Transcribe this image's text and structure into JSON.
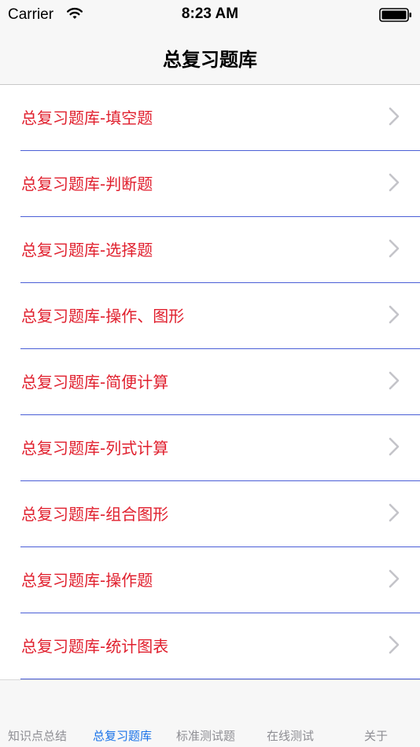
{
  "status_bar": {
    "carrier": "Carrier",
    "time": "8:23 AM"
  },
  "nav": {
    "title": "总复习题库"
  },
  "list": {
    "items": [
      {
        "label": "总复习题库-填空题"
      },
      {
        "label": "总复习题库-判断题"
      },
      {
        "label": "总复习题库-选择题"
      },
      {
        "label": "总复习题库-操作、图形"
      },
      {
        "label": "总复习题库-简便计算"
      },
      {
        "label": "总复习题库-列式计算"
      },
      {
        "label": "总复习题库-组合图形"
      },
      {
        "label": "总复习题库-操作题"
      },
      {
        "label": "总复习题库-统计图表"
      }
    ]
  },
  "tabbar": {
    "tabs": [
      {
        "label": "知识点总结"
      },
      {
        "label": "总复习题库"
      },
      {
        "label": "标准测试题"
      },
      {
        "label": "在线测试"
      },
      {
        "label": "关于"
      }
    ],
    "active_index": 1
  },
  "colors": {
    "item_text": "#e01f2d",
    "separator": "#4b5fd6",
    "tab_active": "#1a73e8",
    "tab_inactive": "#8e8e93"
  },
  "icons": {
    "wifi": "wifi-icon",
    "battery": "battery-icon",
    "chevron": "chevron-right-icon"
  }
}
